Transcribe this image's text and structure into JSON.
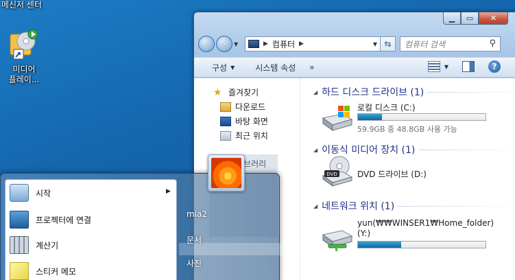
{
  "desktop": {
    "top_label": "메신저 센터",
    "icon_label_line1": "미디어",
    "icon_label_line2": "플레이..."
  },
  "window": {
    "caption": {
      "min": "▁",
      "max": "▭",
      "close": "✕"
    },
    "address": {
      "path": "컴퓨터"
    },
    "search": {
      "placeholder": "컴퓨터 검색"
    },
    "toolbar": {
      "organize": "구성",
      "system_properties": "시스템 속성",
      "more": "»"
    },
    "nav": {
      "favorites": "즐겨찾기",
      "downloads": "다운로드",
      "desktop": "바탕 화면",
      "recent": "최근 위치",
      "library": "라이브러리"
    },
    "groups": {
      "hdd": "하드 디스크 드라이브 (1)",
      "removable": "이동식 미디어 장치 (1)",
      "network": "네트워크 위치 (1)"
    },
    "drives": {
      "local_name": "로컬 디스크 (C:)",
      "local_free": "59.9GB 중 48.8GB 사용 가능",
      "local_used_fraction": 0.19,
      "dvd_name": "DVD 드라이브 (D:)",
      "net_name_line1": "yun(₩₩WINSER1₩Home_folder)",
      "net_name_line2": "(Y:)",
      "net_used_fraction": 0.34
    }
  },
  "startmenu": {
    "left_items": [
      {
        "label": "시작",
        "has_submenu": true
      },
      {
        "label": "프로젝터에 연결"
      },
      {
        "label": "계산기"
      },
      {
        "label": "스티커 메모"
      }
    ],
    "right_items": [
      "mia2",
      "문서",
      "사진"
    ]
  },
  "colors": {
    "accent": "#1e3287",
    "progress": "#1f85b8"
  }
}
